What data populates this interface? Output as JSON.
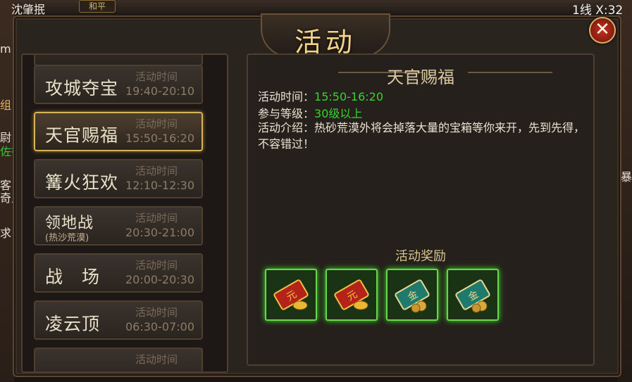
{
  "background": {
    "player_name": "沈肇抿",
    "peace_tag": "和平",
    "line_info": "1线  X:32",
    "left_edge_texts": [
      "m",
      "组",
      "尉",
      "佐行",
      "客",
      "奇人",
      "求"
    ],
    "right_edge_texts": [
      "暴"
    ]
  },
  "window": {
    "title": "活动",
    "close_label": "✕"
  },
  "activity_list": [
    {
      "name": "攻城夺宝",
      "sub": "",
      "time_label": "活动时间",
      "time": "19:40-20:10",
      "selected": false
    },
    {
      "name": "天官赐福",
      "sub": "",
      "time_label": "活动时间",
      "time": "15:50-16:20",
      "selected": true
    },
    {
      "name": "篝火狂欢",
      "sub": "",
      "time_label": "活动时间",
      "time": "12:10-12:30",
      "selected": false
    },
    {
      "name": "领地战",
      "sub": "(热沙荒漠)",
      "time_label": "活动时间",
      "time": "20:30-21:00",
      "selected": false
    },
    {
      "name": "战　场",
      "sub": "",
      "time_label": "活动时间",
      "time": "20:00-20:30",
      "selected": false
    },
    {
      "name": "凌云顶",
      "sub": "",
      "time_label": "活动时间",
      "time": "06:30-07:00",
      "selected": false
    },
    {
      "name": "",
      "sub": "",
      "time_label": "活动时间",
      "time": "",
      "selected": false
    }
  ],
  "detail": {
    "title": "天官赐福",
    "time_label": "活动时间：",
    "time_value": "15:50-16:20",
    "level_label": "参与等级：",
    "level_value": "30级以上",
    "desc_label": "活动介绍：",
    "desc_value": "热砂荒漠外将会掉落大量的宝箱等你来开，先到先得，不容错过！",
    "reward_title": "活动奖励",
    "rewards": [
      {
        "name": "red-ticket-gold-ingot",
        "label": "元"
      },
      {
        "name": "red-ticket-gold-ingot",
        "label": "元"
      },
      {
        "name": "teal-ticket-coins",
        "label": "金"
      },
      {
        "name": "teal-ticket-coins",
        "label": "金"
      }
    ]
  },
  "colors": {
    "accent_gold": "#d8b35a",
    "highlight_green": "#35d52e",
    "reward_glow": "#3fe82c",
    "close_red": "#c6301d"
  }
}
